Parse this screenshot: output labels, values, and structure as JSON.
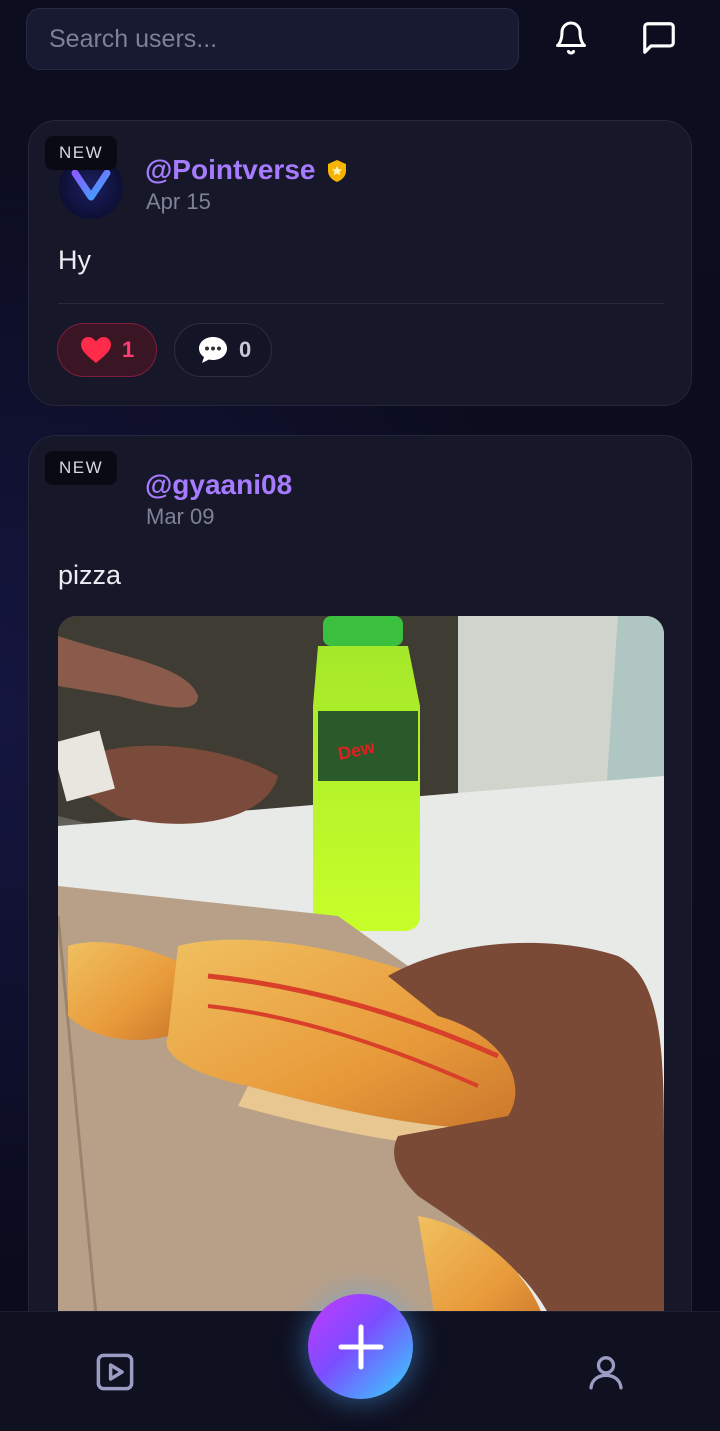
{
  "search": {
    "placeholder": "Search users..."
  },
  "header": {
    "bell_icon": "bell-icon",
    "messages_icon": "chat-bubble-icon"
  },
  "posts": [
    {
      "badge": "NEW",
      "username": "@Pointverse",
      "verified": true,
      "date": "Apr 15",
      "text": "Hy",
      "likes": "1",
      "comments": "0"
    },
    {
      "badge": "NEW",
      "username": "@gyaani08",
      "verified": false,
      "date": "Mar 09",
      "text": "pizza",
      "image_icon": "pizza-photo"
    }
  ],
  "bottom_nav": {
    "left_icon": "video-play-icon",
    "center_icon": "plus-icon",
    "right_icon": "user-profile-icon"
  },
  "colors": {
    "accent": "#a77bff",
    "like": "#ff3d6e",
    "background": "#0b0c1d"
  }
}
